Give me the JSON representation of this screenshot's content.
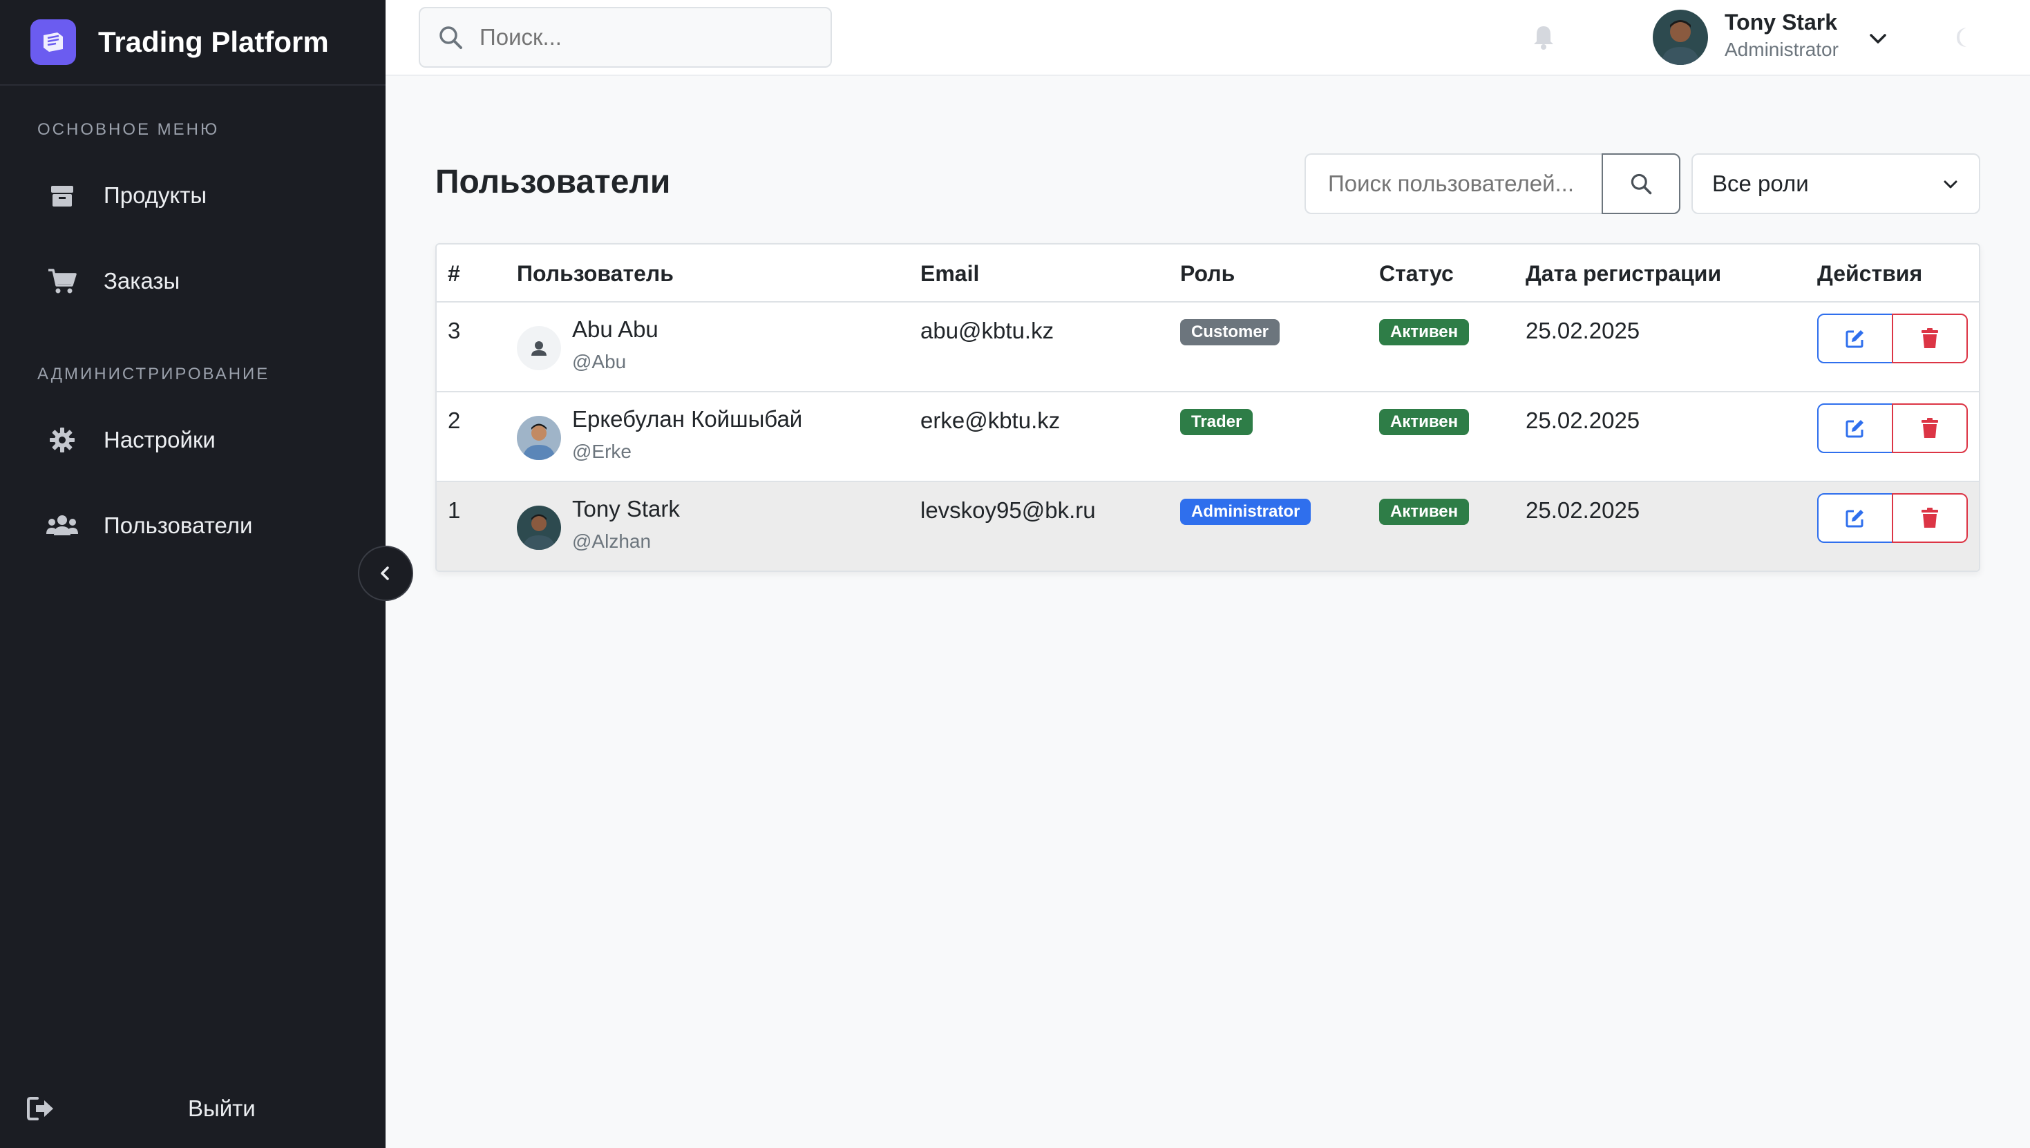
{
  "app": {
    "title": "Trading Platform"
  },
  "sidebar": {
    "section_main": "Основное меню",
    "section_admin": "Администрирование",
    "items": [
      {
        "label": "Продукты",
        "icon": "box-icon"
      },
      {
        "label": "Заказы",
        "icon": "cart-icon"
      },
      {
        "label": "Настройки",
        "icon": "gear-icon"
      },
      {
        "label": "Пользователи",
        "icon": "users-icon"
      }
    ],
    "logout_label": "Выйти"
  },
  "header": {
    "search_placeholder": "Поиск...",
    "user_name": "Tony Stark",
    "user_role": "Administrator"
  },
  "page": {
    "title": "Пользователи",
    "user_search_placeholder": "Поиск пользователей...",
    "role_filter": "Все роли"
  },
  "table": {
    "columns": [
      "#",
      "Пользователь",
      "Email",
      "Роль",
      "Статус",
      "Дата регистрации",
      "Действия"
    ],
    "rows": [
      {
        "id": "3",
        "name": "Abu Abu",
        "handle": "@Abu",
        "email": "abu@kbtu.kz",
        "role": "Customer",
        "role_color": "#6c757d",
        "status": "Активен",
        "date": "25.02.2025"
      },
      {
        "id": "2",
        "name": "Еркебулан Койшыбай",
        "handle": "@Erke",
        "email": "erke@kbtu.kz",
        "role": "Trader",
        "role_color": "#2e7d47",
        "status": "Активен",
        "date": "25.02.2025"
      },
      {
        "id": "1",
        "name": "Tony Stark",
        "handle": "@Alzhan",
        "email": "levskoy95@bk.ru",
        "role": "Administrator",
        "role_color": "#2f6fed",
        "status": "Активен",
        "date": "25.02.2025"
      }
    ]
  },
  "colors": {
    "sidebar_bg": "#1b1d23",
    "brand_accent": "#6b5cf0",
    "status_active": "#2e7d47",
    "edit_blue": "#2f6fed",
    "delete_red": "#dc3545"
  }
}
